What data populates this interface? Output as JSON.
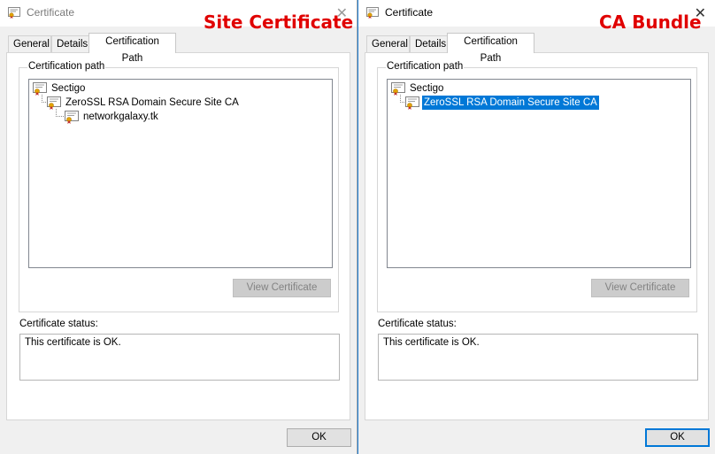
{
  "dialogs": [
    {
      "title": "Certificate",
      "overlay_label": "Site Certificate",
      "tabs": [
        "General",
        "Details",
        "Certification Path"
      ],
      "group_title": "Certification path",
      "tree": [
        "Sectigo",
        "ZeroSSL RSA Domain Secure Site CA",
        "networkgalaxy.tk"
      ],
      "view_button": "View Certificate",
      "status_label": "Certificate status:",
      "status_text": "This certificate is OK.",
      "ok_label": "OK"
    },
    {
      "title": "Certificate",
      "overlay_label": "CA Bundle",
      "tabs": [
        "General",
        "Details",
        "Certification Path"
      ],
      "group_title": "Certification path",
      "tree": [
        "Sectigo",
        "ZeroSSL RSA Domain Secure Site CA"
      ],
      "selected_node": "ZeroSSL RSA Domain Secure Site CA",
      "view_button": "View Certificate",
      "status_label": "Certificate status:",
      "status_text": "This certificate is OK.",
      "ok_label": "OK"
    }
  ],
  "colors": {
    "overlay_label": "#e00000",
    "selection": "#0078d7",
    "dialog_background": "#f0f0f0"
  },
  "icons": {
    "title": "certificate-icon",
    "tree_node": "certificate-icon",
    "close": "close-icon"
  }
}
